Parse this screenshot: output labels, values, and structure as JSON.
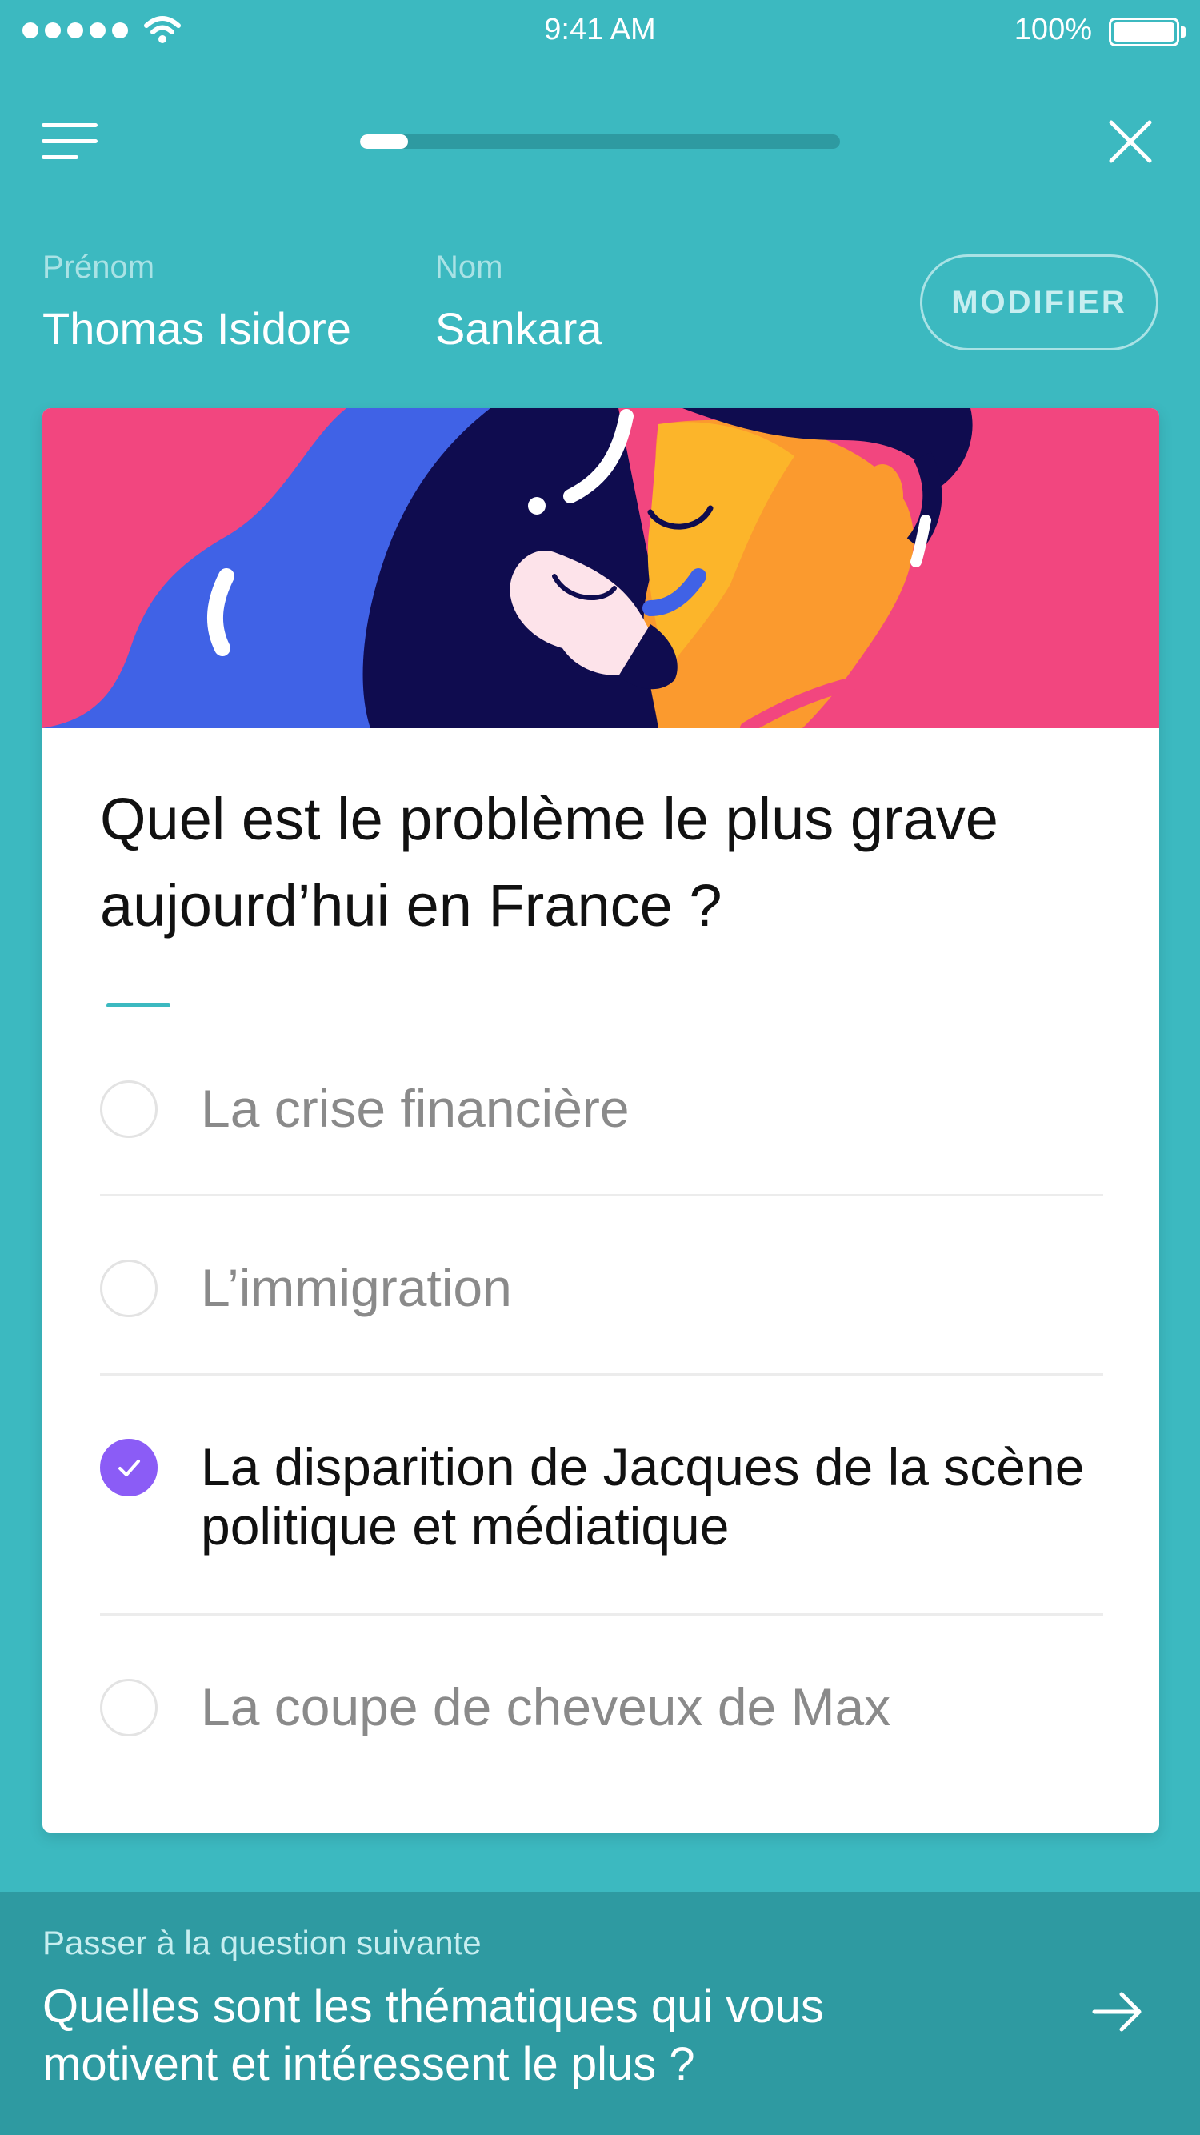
{
  "status_bar": {
    "time": "9:41 AM",
    "battery": "100%",
    "icons": [
      "signal-dots-icon",
      "wifi-icon",
      "battery-icon"
    ]
  },
  "nav": {
    "menu_icon": "hamburger-menu-icon",
    "progress": 0.1,
    "close_icon": "close-icon"
  },
  "profile": {
    "first_name_label": "Prénom",
    "first_name": "Thomas Isidore",
    "last_name_label": "Nom",
    "last_name": "Sankara",
    "modify_button": "MODIFIER"
  },
  "question": {
    "text": "Quel est le problème le plus grave aujourd’hui  en France ?",
    "options": [
      {
        "label": "La crise financière",
        "selected": false
      },
      {
        "label": "L’immigration",
        "selected": false
      },
      {
        "label": "La disparition de Jacques de la scène politique et médiatique",
        "selected": true
      },
      {
        "label": "La coupe de cheveux de Max",
        "selected": false
      }
    ]
  },
  "next": {
    "label": "Passer à la question suivante",
    "question": "Quelles sont les thématiques qui vous motivent et intéressent le plus ?",
    "arrow_icon": "arrow-right-icon"
  },
  "colors": {
    "background": "#3cb9c0",
    "footer": "#2e9aa1",
    "selected": "#8b5cf6",
    "illustration_pink": "#f2467f",
    "illustration_blue": "#4062e6",
    "illustration_navy": "#0f0c4f",
    "illustration_orange": "#fb9a2e"
  }
}
